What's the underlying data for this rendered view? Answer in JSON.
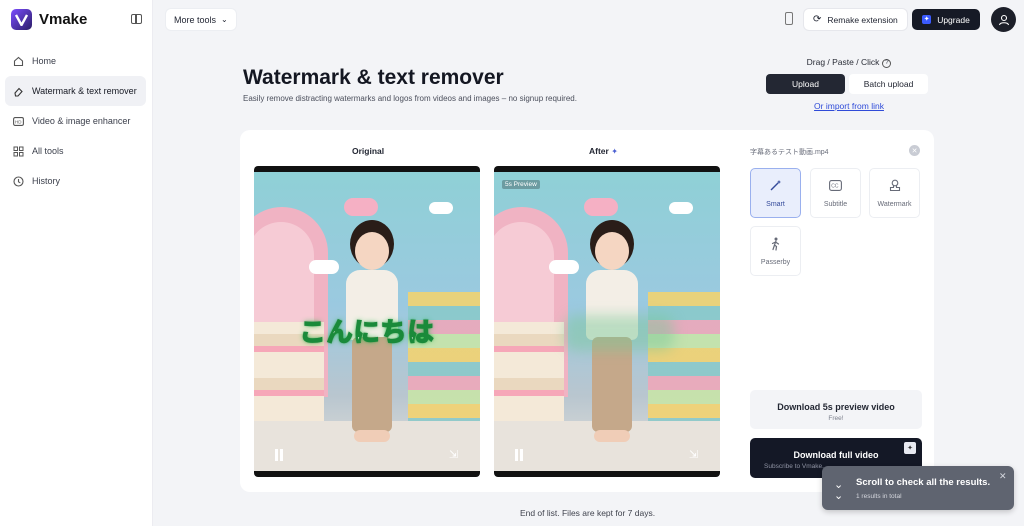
{
  "brand": {
    "name": "Vmake",
    "accent": "#6a3df0"
  },
  "sidebar": {
    "items": [
      {
        "label": "Home",
        "icon": "home-icon"
      },
      {
        "label": "Watermark & text remover",
        "icon": "eraser-icon",
        "active": true
      },
      {
        "label": "Video & image enhancer",
        "icon": "hd-icon"
      },
      {
        "label": "All tools",
        "icon": "grid-icon"
      },
      {
        "label": "History",
        "icon": "clock-icon"
      }
    ]
  },
  "header": {
    "more_tools": "More tools",
    "remake_extension": "Remake extension",
    "upgrade": "Upgrade"
  },
  "page": {
    "title": "Watermark & text remover",
    "subtitle": "Easily remove distracting watermarks and logos from videos and images – no signup required."
  },
  "upload": {
    "hint": "Drag / Paste / Click",
    "upload_label": "Upload",
    "batch_label": "Batch upload",
    "import_link": "Or import from link"
  },
  "preview": {
    "original_label": "Original",
    "after_label": "After",
    "preview_tag": "5s Preview",
    "overlay_text": "こんにちは"
  },
  "panel": {
    "file_name": "字幕あるテスト動画.mp4",
    "modes": [
      {
        "label": "Smart",
        "icon": "magic-wand-icon",
        "active": true
      },
      {
        "label": "Subtitle",
        "icon": "cc-icon"
      },
      {
        "label": "Watermark",
        "icon": "stamp-icon"
      },
      {
        "label": "Passerby",
        "icon": "walking-person-icon"
      }
    ],
    "download_preview": {
      "title": "Download 5s preview video",
      "sub": "Free!"
    },
    "download_full": {
      "title": "Download full video",
      "sub": "Subscribe to Vmake..."
    }
  },
  "footer": {
    "end_note": "End of list. Files are kept for 7 days."
  },
  "toast": {
    "title": "Scroll to check all the results.",
    "sub": "1 results in total"
  }
}
